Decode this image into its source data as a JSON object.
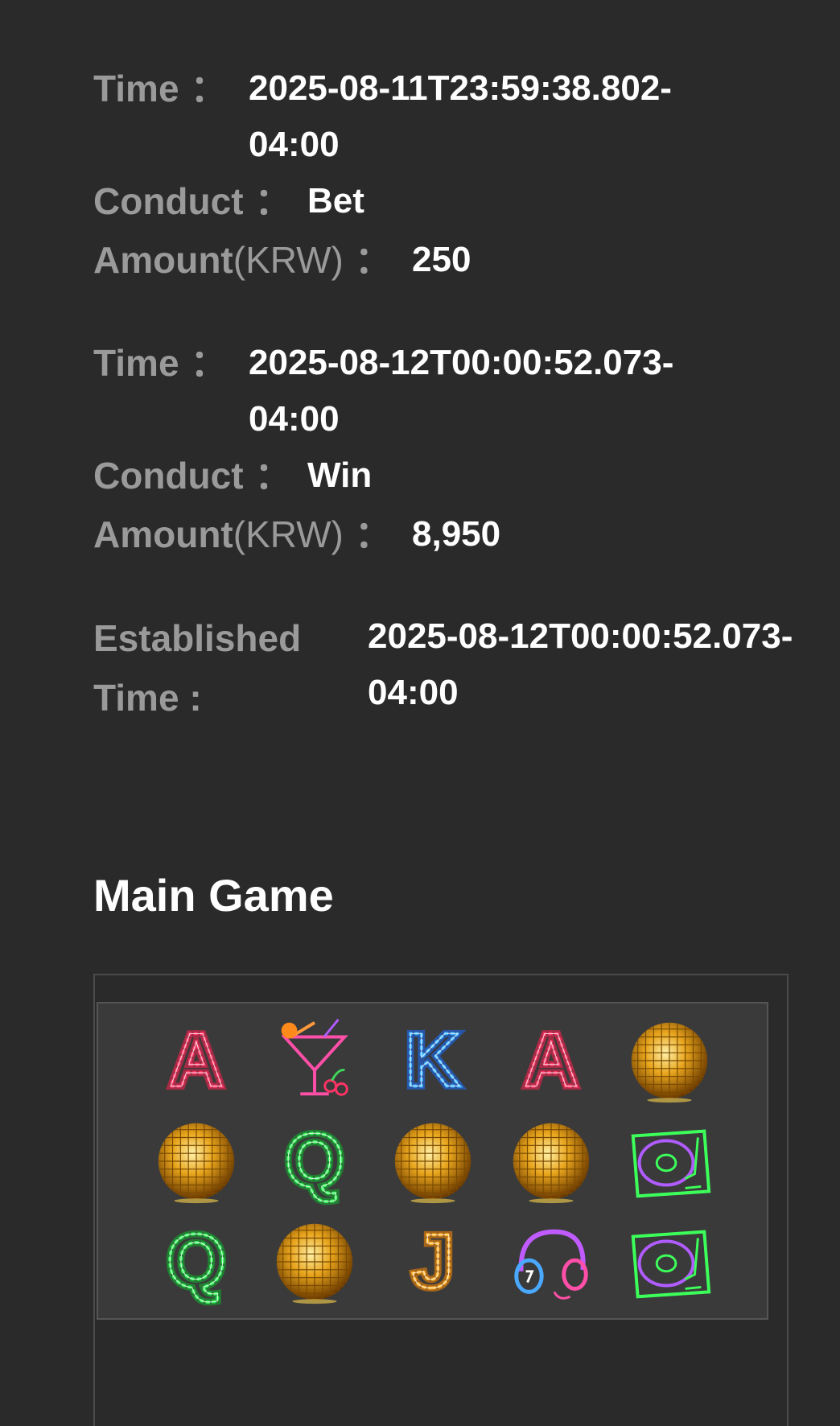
{
  "records": [
    {
      "time_label": "Time",
      "time_value": "2025-08-11T23:59:38.802-04:00",
      "conduct_label": "Conduct",
      "conduct_value": "Bet",
      "amount_label": "Amount",
      "amount_unit": "(KRW)",
      "amount_value": "250"
    },
    {
      "time_label": "Time",
      "time_value": "2025-08-12T00:00:52.073-04:00",
      "conduct_label": "Conduct",
      "conduct_value": "Win",
      "amount_label": "Amount",
      "amount_unit": "(KRW)",
      "amount_value": "8,950"
    }
  ],
  "colon": "：",
  "established": {
    "label": "Established Time :",
    "value": "2025-08-12T00:00:52.073-04:00"
  },
  "main_game": {
    "title": "Main Game",
    "grid": [
      [
        "A-red-neon-icon",
        "cocktail-neon-icon",
        "K-blue-neon-icon",
        "A-red-neon-icon",
        "disco-ball-icon"
      ],
      [
        "disco-ball-icon",
        "Q-green-neon-icon",
        "disco-ball-icon",
        "disco-ball-icon",
        "turntable-icon"
      ],
      [
        "Q-green-neon-icon",
        "disco-ball-icon",
        "J-orange-neon-icon",
        "headphones-icon",
        "turntable-icon"
      ]
    ]
  }
}
